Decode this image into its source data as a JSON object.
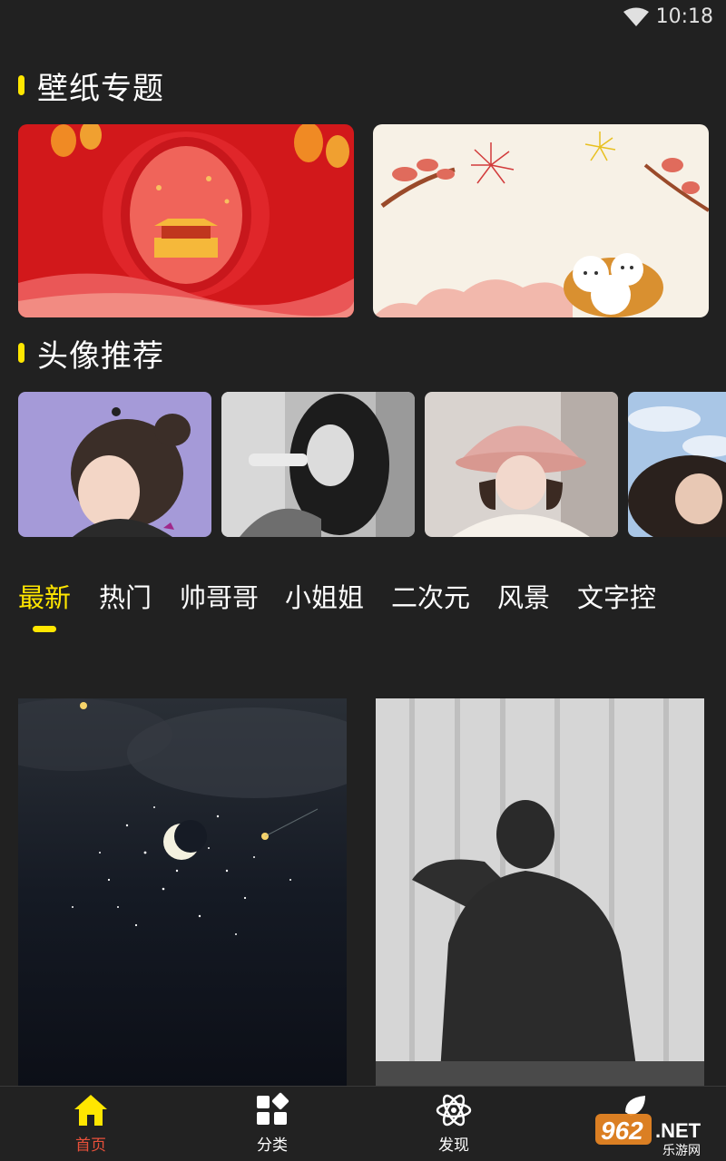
{
  "status_bar": {
    "time": "10:18"
  },
  "wallpaper_section": {
    "title": "壁纸专题"
  },
  "avatar_section": {
    "title": "头像推荐"
  },
  "category_tabs": [
    {
      "label": "最新",
      "active": true
    },
    {
      "label": "热门",
      "active": false
    },
    {
      "label": "帅哥哥",
      "active": false
    },
    {
      "label": "小姐姐",
      "active": false
    },
    {
      "label": "二次元",
      "active": false
    },
    {
      "label": "风景",
      "active": false
    },
    {
      "label": "文字控",
      "active": false
    }
  ],
  "bottom_nav": [
    {
      "label": "首页",
      "icon": "home-icon",
      "active": true
    },
    {
      "label": "分类",
      "icon": "category-icon",
      "active": false
    },
    {
      "label": "发现",
      "icon": "atom-icon",
      "active": false
    },
    {
      "label": "",
      "icon": "leaf-icon",
      "active": false
    }
  ],
  "watermark": {
    "brand": "962",
    "suffix": ".NET",
    "subtitle": "乐游网"
  },
  "colors": {
    "accent": "#ffe600",
    "nav_active": "#e8503a",
    "background": "#212121"
  }
}
